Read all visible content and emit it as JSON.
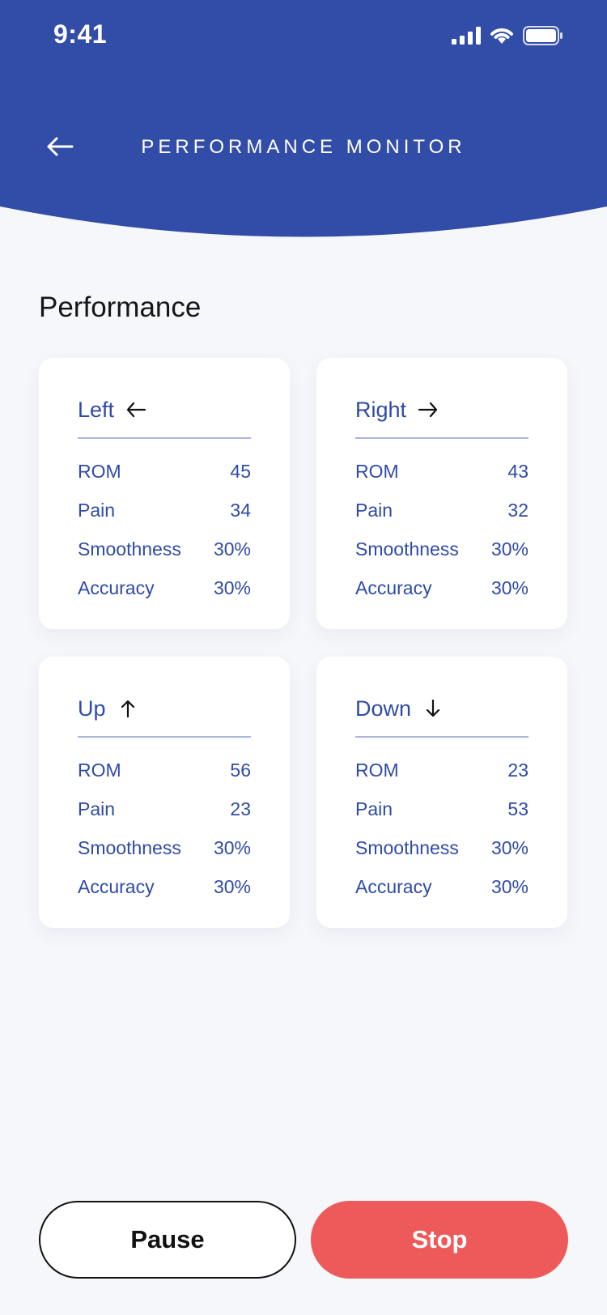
{
  "status_bar": {
    "time": "9:41"
  },
  "header": {
    "title": "PERFORMANCE MONITOR",
    "back_icon": "arrow-left-icon",
    "background_color": "#324da7"
  },
  "section_title": "Performance",
  "cards": [
    {
      "title": "Left",
      "arrow_icon": "arrow-left-icon",
      "metrics": [
        {
          "label": "ROM",
          "value": "45"
        },
        {
          "label": "Pain",
          "value": "34"
        },
        {
          "label": "Smoothness",
          "value": "30%"
        },
        {
          "label": "Accuracy",
          "value": "30%"
        }
      ]
    },
    {
      "title": "Right",
      "arrow_icon": "arrow-right-icon",
      "metrics": [
        {
          "label": "ROM",
          "value": "43"
        },
        {
          "label": "Pain",
          "value": "32"
        },
        {
          "label": "Smoothness",
          "value": "30%"
        },
        {
          "label": "Accuracy",
          "value": "30%"
        }
      ]
    },
    {
      "title": "Up",
      "arrow_icon": "arrow-up-icon",
      "metrics": [
        {
          "label": "ROM",
          "value": "56"
        },
        {
          "label": "Pain",
          "value": "23"
        },
        {
          "label": "Smoothness",
          "value": "30%"
        },
        {
          "label": "Accuracy",
          "value": "30%"
        }
      ]
    },
    {
      "title": "Down",
      "arrow_icon": "arrow-down-icon",
      "metrics": [
        {
          "label": "ROM",
          "value": "23"
        },
        {
          "label": "Pain",
          "value": "53"
        },
        {
          "label": "Smoothness",
          "value": "30%"
        },
        {
          "label": "Accuracy",
          "value": "30%"
        }
      ]
    }
  ],
  "buttons": {
    "pause_label": "Pause",
    "stop_label": "Stop",
    "stop_color": "#ee5a5a"
  },
  "colors": {
    "accent": "#324da7",
    "text_blue": "#2f4ba6",
    "page_background": "#f6f7fb"
  }
}
